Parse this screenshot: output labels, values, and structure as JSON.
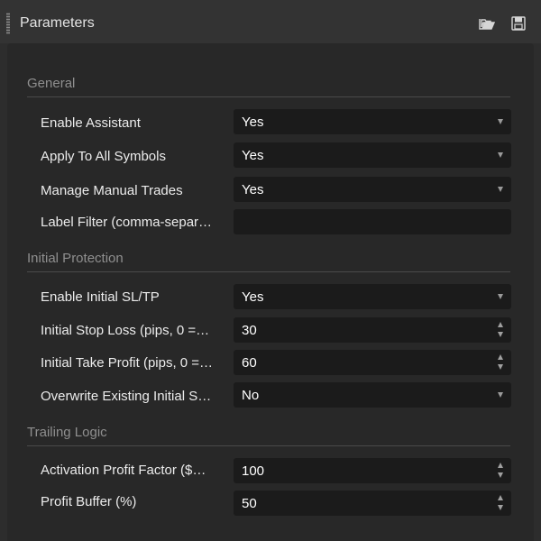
{
  "window": {
    "title": "Parameters",
    "icons": {
      "open": "open-folder-icon",
      "save": "save-icon"
    }
  },
  "sections": [
    {
      "label": "General"
    },
    {
      "label": "Initial Protection"
    },
    {
      "label": "Trailing Logic"
    }
  ],
  "params": [
    {
      "label": "Enable Assistant",
      "value": "Yes",
      "kind": "dropdown"
    },
    {
      "label": "Apply To All Symbols",
      "value": "Yes",
      "kind": "dropdown"
    },
    {
      "label": "Manage Manual Trades",
      "value": "Yes",
      "kind": "dropdown"
    },
    {
      "label": "Label Filter (comma-separ…",
      "value": "",
      "kind": "text"
    },
    {
      "label": "Enable Initial SL/TP",
      "value": "Yes",
      "kind": "dropdown"
    },
    {
      "label": "Initial Stop Loss (pips, 0 =…",
      "value": "30",
      "kind": "number"
    },
    {
      "label": "Initial Take Profit (pips, 0 =…",
      "value": "60",
      "kind": "number"
    },
    {
      "label": "Overwrite Existing Initial S…",
      "value": "No",
      "kind": "dropdown"
    },
    {
      "label": "Activation Profit Factor ($…",
      "value": "100",
      "kind": "number"
    },
    {
      "label": "Profit Buffer (%)",
      "value": "50",
      "kind": "number"
    }
  ]
}
